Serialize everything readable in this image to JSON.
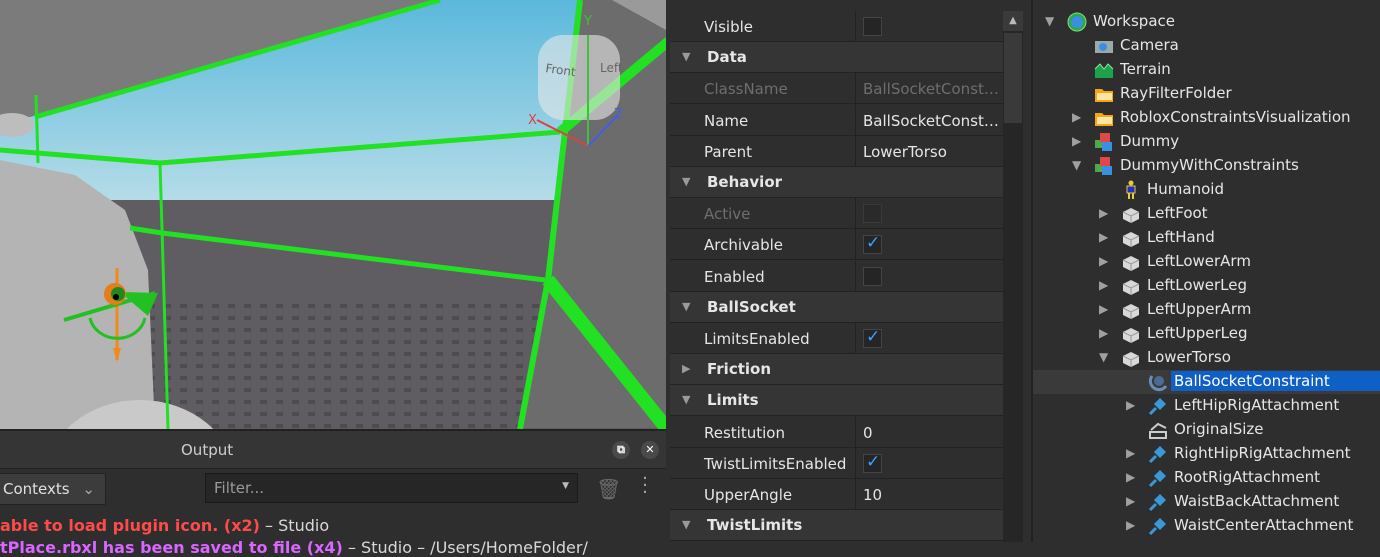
{
  "viewport": {
    "viewcube_front": "Front",
    "viewcube_left": "Left",
    "axis_x": "X",
    "axis_y": "Y",
    "axis_z": "Z",
    "colors": {
      "constraint_green": "#22e022",
      "sky": "#8fcbe0",
      "ground": "#5f5c62"
    }
  },
  "output": {
    "title": "Output",
    "contexts_label": "Contexts",
    "filter_placeholder": "Filter...",
    "logs": [
      {
        "message": "able to load plugin icon. (x2)",
        "sep": " – ",
        "source": "Studio",
        "kind": "error"
      },
      {
        "message": "tPlace.rbxl has been saved to file (x4)",
        "sep": " – ",
        "source": "Studio – /Users/HomeFolder/",
        "kind": "warn"
      }
    ]
  },
  "properties": {
    "rows": [
      {
        "type": "prop",
        "name": "Visible",
        "kind": "checkbox",
        "checked": false
      },
      {
        "type": "header",
        "name": "Data"
      },
      {
        "type": "prop",
        "name": "ClassName",
        "kind": "text",
        "value": "BallSocketConst…",
        "disabled": true
      },
      {
        "type": "prop",
        "name": "Name",
        "kind": "text",
        "value": "BallSocketConst…"
      },
      {
        "type": "prop",
        "name": "Parent",
        "kind": "text",
        "value": "LowerTorso"
      },
      {
        "type": "header",
        "name": "Behavior"
      },
      {
        "type": "prop",
        "name": "Active",
        "kind": "checkbox",
        "checked": false,
        "disabled": true
      },
      {
        "type": "prop",
        "name": "Archivable",
        "kind": "checkbox",
        "checked": true
      },
      {
        "type": "prop",
        "name": "Enabled",
        "kind": "checkbox",
        "checked": false
      },
      {
        "type": "header",
        "name": "BallSocket"
      },
      {
        "type": "prop",
        "name": "LimitsEnabled",
        "kind": "checkbox",
        "checked": true
      },
      {
        "type": "header",
        "name": "Friction",
        "collapsed": true
      },
      {
        "type": "header",
        "name": "Limits"
      },
      {
        "type": "prop",
        "name": "Restitution",
        "kind": "text",
        "value": "0"
      },
      {
        "type": "prop",
        "name": "TwistLimitsEnabled",
        "kind": "checkbox",
        "checked": true
      },
      {
        "type": "prop",
        "name": "UpperAngle",
        "kind": "text",
        "value": "10"
      },
      {
        "type": "header",
        "name": "TwistLimits"
      }
    ]
  },
  "explorer": {
    "items": [
      {
        "label": "Workspace",
        "depth": 0,
        "arrow": "open",
        "icon": "globe"
      },
      {
        "label": "Camera",
        "depth": 1,
        "arrow": "none",
        "icon": "camera"
      },
      {
        "label": "Terrain",
        "depth": 1,
        "arrow": "none",
        "icon": "terrain"
      },
      {
        "label": "RayFilterFolder",
        "depth": 1,
        "arrow": "none",
        "icon": "folder"
      },
      {
        "label": "RobloxConstraintsVisualization",
        "depth": 1,
        "arrow": "closed",
        "icon": "folder"
      },
      {
        "label": "Dummy",
        "depth": 1,
        "arrow": "closed",
        "icon": "model"
      },
      {
        "label": "DummyWithConstraints",
        "depth": 1,
        "arrow": "open",
        "icon": "model"
      },
      {
        "label": "Humanoid",
        "depth": 2,
        "arrow": "none",
        "icon": "humanoid"
      },
      {
        "label": "LeftFoot",
        "depth": 2,
        "arrow": "closed",
        "icon": "meshpart"
      },
      {
        "label": "LeftHand",
        "depth": 2,
        "arrow": "closed",
        "icon": "meshpart"
      },
      {
        "label": "LeftLowerArm",
        "depth": 2,
        "arrow": "closed",
        "icon": "meshpart"
      },
      {
        "label": "LeftLowerLeg",
        "depth": 2,
        "arrow": "closed",
        "icon": "meshpart"
      },
      {
        "label": "LeftUpperArm",
        "depth": 2,
        "arrow": "closed",
        "icon": "meshpart"
      },
      {
        "label": "LeftUpperLeg",
        "depth": 2,
        "arrow": "closed",
        "icon": "meshpart"
      },
      {
        "label": "LowerTorso",
        "depth": 2,
        "arrow": "open",
        "icon": "meshpart"
      },
      {
        "label": "BallSocketConstraint",
        "depth": 3,
        "arrow": "none",
        "icon": "ballsocket",
        "selected": true
      },
      {
        "label": "LeftHipRigAttachment",
        "depth": 3,
        "arrow": "closed",
        "icon": "attachment"
      },
      {
        "label": "OriginalSize",
        "depth": 3,
        "arrow": "none",
        "icon": "value"
      },
      {
        "label": "RightHipRigAttachment",
        "depth": 3,
        "arrow": "closed",
        "icon": "attachment"
      },
      {
        "label": "RootRigAttachment",
        "depth": 3,
        "arrow": "closed",
        "icon": "attachment"
      },
      {
        "label": "WaistBackAttachment",
        "depth": 3,
        "arrow": "closed",
        "icon": "attachment"
      },
      {
        "label": "WaistCenterAttachment",
        "depth": 3,
        "arrow": "closed",
        "icon": "attachment"
      }
    ]
  }
}
